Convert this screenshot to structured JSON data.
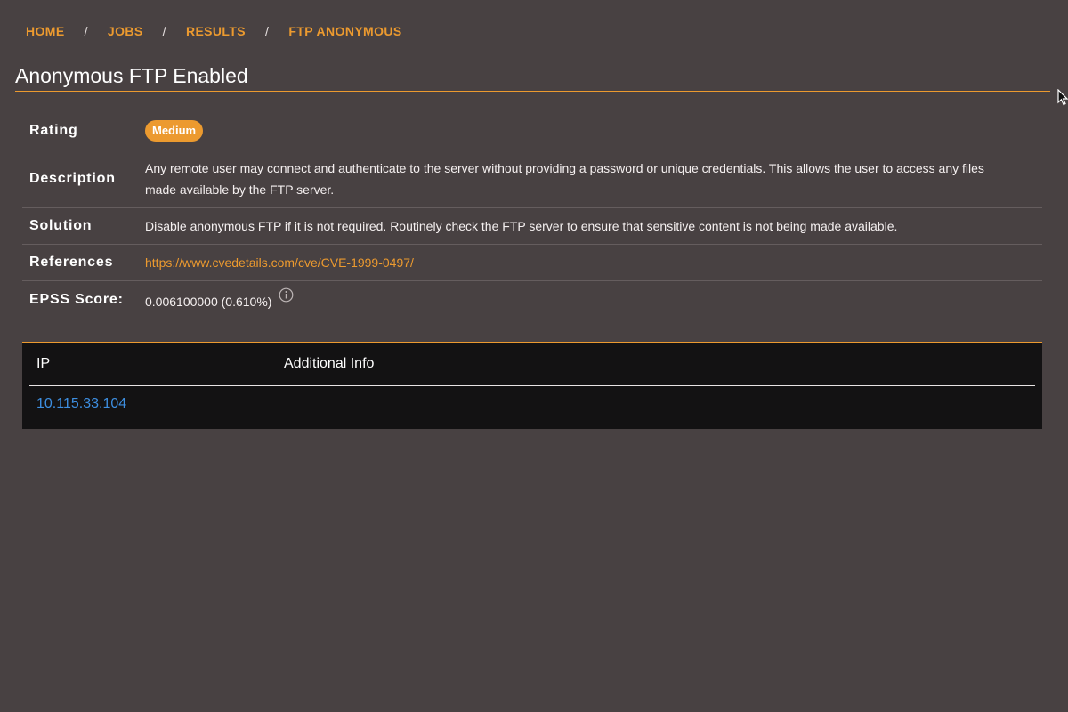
{
  "breadcrumb": {
    "items": [
      {
        "label": "HOME"
      },
      {
        "label": "JOBS"
      },
      {
        "label": "RESULTS"
      },
      {
        "label": "FTP ANONYMOUS"
      }
    ],
    "separator": "/"
  },
  "page": {
    "title": "Anonymous FTP Enabled"
  },
  "details": {
    "rating_label": "Rating",
    "rating_value": "Medium",
    "description_label": "Description",
    "description_value": "Any remote user may connect and authenticate to the server without providing a password or unique credentials. This allows the user to access any files made available by the FTP server.",
    "solution_label": "Solution",
    "solution_value": "Disable anonymous FTP if it is not required. Routinely check the FTP server to ensure that sensitive content is not being made available.",
    "references_label": "References",
    "references_value": "https://www.cvedetails.com/cve/CVE-1999-0497/",
    "epss_label": "EPSS Score:",
    "epss_value": "0.006100000 (0.610%)"
  },
  "hosts": {
    "columns": [
      "IP",
      "Additional Info"
    ],
    "rows": [
      {
        "ip": "10.115.33.104",
        "info": ""
      }
    ]
  },
  "colors": {
    "background": "#484142",
    "accent": "#ec9a2f",
    "link_blue": "#3d8ee0",
    "table_bg": "#131213"
  },
  "icons": {
    "epss_info": "info-circle-icon",
    "mouse_cursor": "arrow-cursor-icon"
  }
}
